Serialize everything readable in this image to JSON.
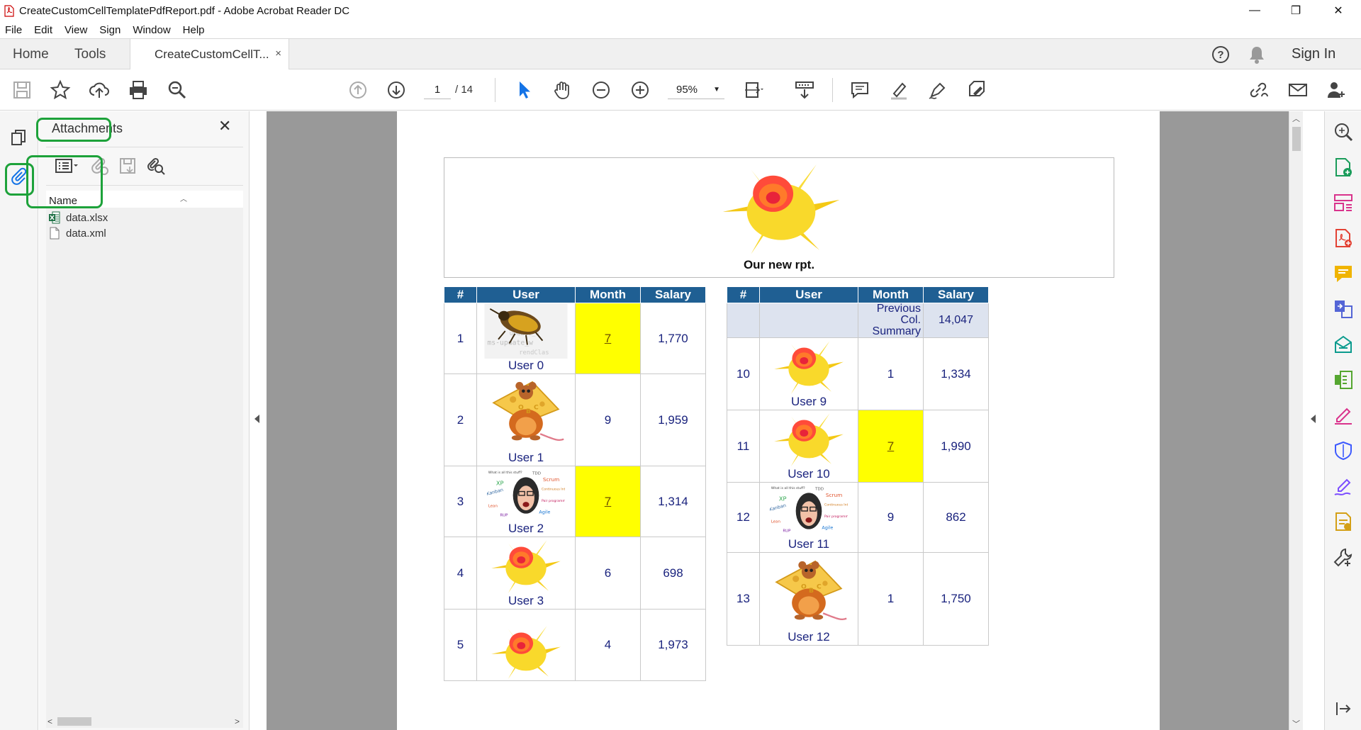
{
  "window": {
    "title": "CreateCustomCellTemplatePdfReport.pdf - Adobe Acrobat Reader DC",
    "minimize": "—",
    "restore": "❐",
    "close": "✕"
  },
  "menu": [
    "File",
    "Edit",
    "View",
    "Sign",
    "Window",
    "Help"
  ],
  "tabs": {
    "home": "Home",
    "tools": "Tools",
    "document": "CreateCustomCellT...",
    "document_close": "×",
    "sign_in": "Sign In"
  },
  "toolbar": {
    "page_current": "1",
    "page_total": "/ 14",
    "zoom": "95%"
  },
  "attachments": {
    "header": "Attachments",
    "close": "✕",
    "column_name": "Name",
    "files": [
      {
        "name": "data.xlsx",
        "icon": "excel-file-icon"
      },
      {
        "name": "data.xml",
        "icon": "blank-file-icon"
      }
    ]
  },
  "report": {
    "caption": "Our new rpt.",
    "columns": [
      "#",
      "User",
      "Month",
      "Salary"
    ],
    "left_rows": [
      {
        "num": "1",
        "user": "User 0",
        "image": "bug",
        "month": "7",
        "highlight": true,
        "salary": "1,770"
      },
      {
        "num": "2",
        "user": "User 1",
        "image": "mouse",
        "month": "9",
        "highlight": false,
        "salary": "1,959"
      },
      {
        "num": "3",
        "user": "User 2",
        "image": "agile",
        "month": "7",
        "highlight": true,
        "salary": "1,314"
      },
      {
        "num": "4",
        "user": "User 3",
        "image": "flower",
        "month": "6",
        "highlight": false,
        "salary": "698"
      },
      {
        "num": "5",
        "user": "",
        "image": "flower",
        "month": "4",
        "highlight": false,
        "salary": "1,973"
      }
    ],
    "summary": {
      "label": "Previous Col. Summary",
      "value": "14,047"
    },
    "right_rows": [
      {
        "num": "10",
        "user": "User 9",
        "image": "flower",
        "month": "1",
        "highlight": false,
        "salary": "1,334"
      },
      {
        "num": "11",
        "user": "User 10",
        "image": "flower",
        "month": "7",
        "highlight": true,
        "salary": "1,990"
      },
      {
        "num": "12",
        "user": "User 11",
        "image": "agile",
        "month": "9",
        "highlight": false,
        "salary": "862"
      },
      {
        "num": "13",
        "user": "User 12",
        "image": "mouse",
        "month": "1",
        "highlight": false,
        "salary": "1,750"
      }
    ],
    "agile_words": [
      "What is all this stuff?",
      "TDD",
      "XP",
      "Scrum",
      "Kanban",
      "Continuous Integration",
      "Lean",
      "Pair programming",
      "RUP",
      "Agile"
    ],
    "bug_words": [
      "class",
      "update_w",
      "ms-update_w",
      "rendClas"
    ],
    "mouse_letters": [
      "O",
      "B",
      "C"
    ]
  },
  "colors": {
    "header_blue": "#1f5f93",
    "highlight_yellow": "#ffff00",
    "text_navy": "#1a237e",
    "annotation_green": "#1da23a"
  }
}
